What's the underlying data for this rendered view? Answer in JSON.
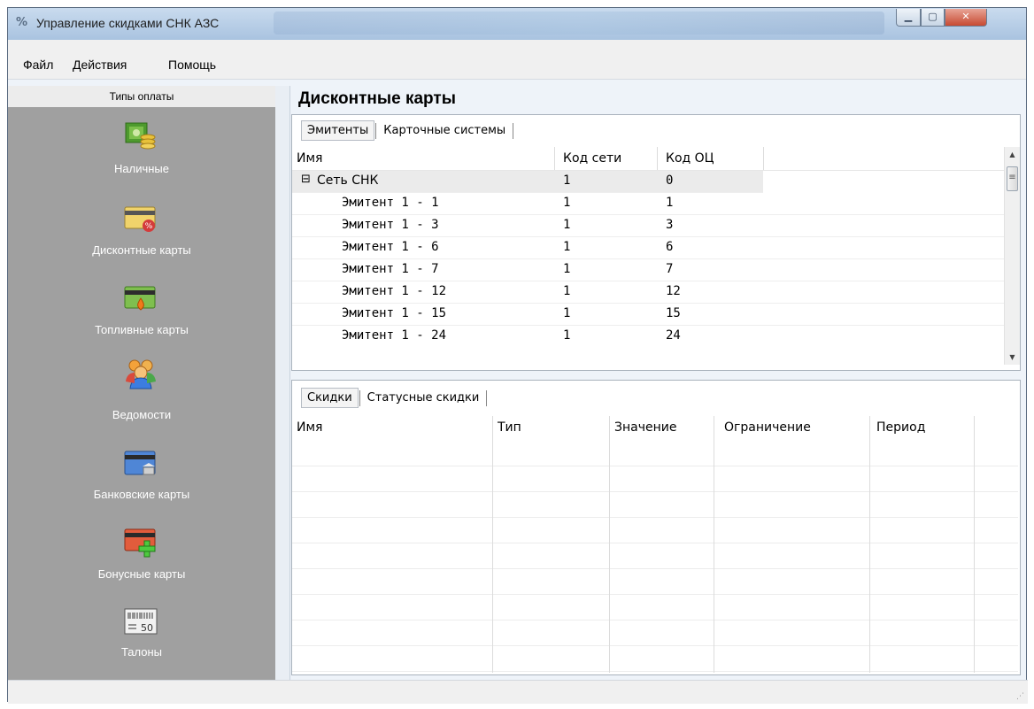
{
  "window": {
    "title": "Управление скидками СНК АЗС",
    "app_icon": "percent-icon",
    "controls": {
      "minimize": "minimize-icon",
      "maximize": "maximize-icon",
      "close": "close-icon"
    }
  },
  "menu": [
    "Файл",
    "Действия",
    "Помощь"
  ],
  "sidebar": {
    "header": "Типы оплаты",
    "items": [
      {
        "label": "Наличные",
        "icon": "cash-icon"
      },
      {
        "label": "Дисконтные карты",
        "icon": "discount-card-icon"
      },
      {
        "label": "Топливные карты",
        "icon": "fuel-card-icon"
      },
      {
        "label": "Ведомости",
        "icon": "people-icon"
      },
      {
        "label": "Банковские карты",
        "icon": "bank-card-icon"
      },
      {
        "label": "Бонусные карты",
        "icon": "bonus-card-icon"
      },
      {
        "label": "Талоны",
        "icon": "coupon-icon"
      }
    ]
  },
  "main": {
    "title": "Дисконтные карты",
    "top_tabs": [
      "Эмитенты",
      "Карточные системы"
    ],
    "issuers_table": {
      "columns": [
        "Имя",
        "Код сети",
        "Код ОЦ"
      ],
      "group": {
        "toggle": "⊟",
        "name": "Сеть СНК",
        "network_code": "1",
        "oc_code": "0"
      },
      "rows": [
        {
          "name": "Эмитент 1 - 1",
          "network_code": "1",
          "oc_code": "1"
        },
        {
          "name": "Эмитент 1 - 3",
          "network_code": "1",
          "oc_code": "3"
        },
        {
          "name": "Эмитент 1 - 6",
          "network_code": "1",
          "oc_code": "6"
        },
        {
          "name": "Эмитент 1 - 7",
          "network_code": "1",
          "oc_code": "7"
        },
        {
          "name": "Эмитент 1 - 12",
          "network_code": "1",
          "oc_code": "12"
        },
        {
          "name": "Эмитент 1 - 15",
          "network_code": "1",
          "oc_code": "15"
        },
        {
          "name": "Эмитент 1 - 24",
          "network_code": "1",
          "oc_code": "24"
        }
      ]
    },
    "bottom_tabs": [
      "Скидки",
      "Статусные скидки"
    ],
    "discounts_table": {
      "columns": [
        "Имя",
        "Тип",
        "Значение",
        "Ограничение",
        "Период"
      ],
      "rows": []
    }
  },
  "colors": {
    "sidebar_bg": "#a0a0a0",
    "group_row_bg": "#ebebeb"
  }
}
